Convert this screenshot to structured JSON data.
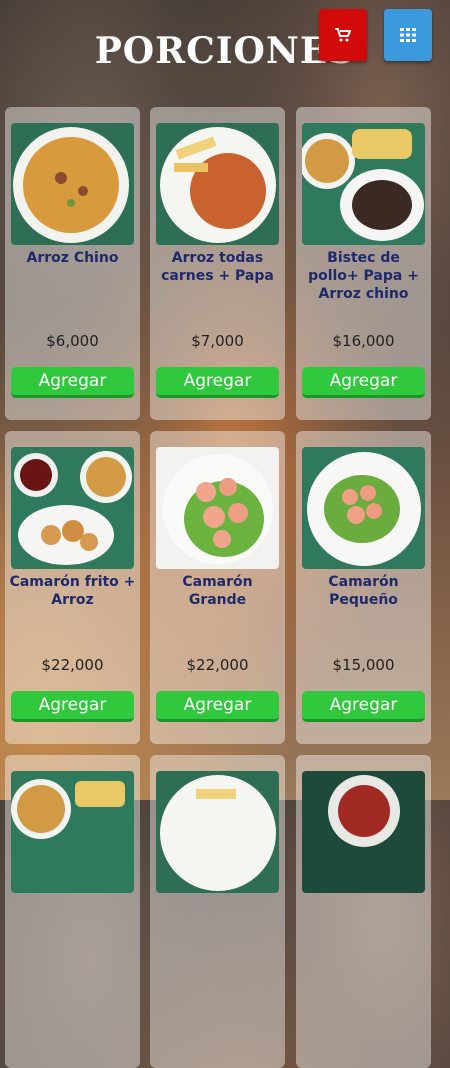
{
  "page": {
    "title": "PORCIONES"
  },
  "icons": {
    "cart": "cart-icon",
    "grid": "grid-icon"
  },
  "colors": {
    "cart_button": "#d10a0a",
    "grid_button": "#3a9adb",
    "add_button": "#30c83c",
    "name_text": "#1f2a6b"
  },
  "products": [
    {
      "name": "Arroz Chino",
      "price": "$6,000",
      "button": "Agregar"
    },
    {
      "name": "Arroz todas carnes + Papa",
      "price": "$7,000",
      "button": "Agregar"
    },
    {
      "name": "Bistec de pollo+ Papa + Arroz chino",
      "price": "$16,000",
      "button": "Agregar"
    },
    {
      "name": "Camarón frito + Arroz",
      "price": "$22,000",
      "button": "Agregar"
    },
    {
      "name": "Camarón Grande",
      "price": "$22,000",
      "button": "Agregar"
    },
    {
      "name": "Camarón Pequeño",
      "price": "$15,000",
      "button": "Agregar"
    }
  ]
}
